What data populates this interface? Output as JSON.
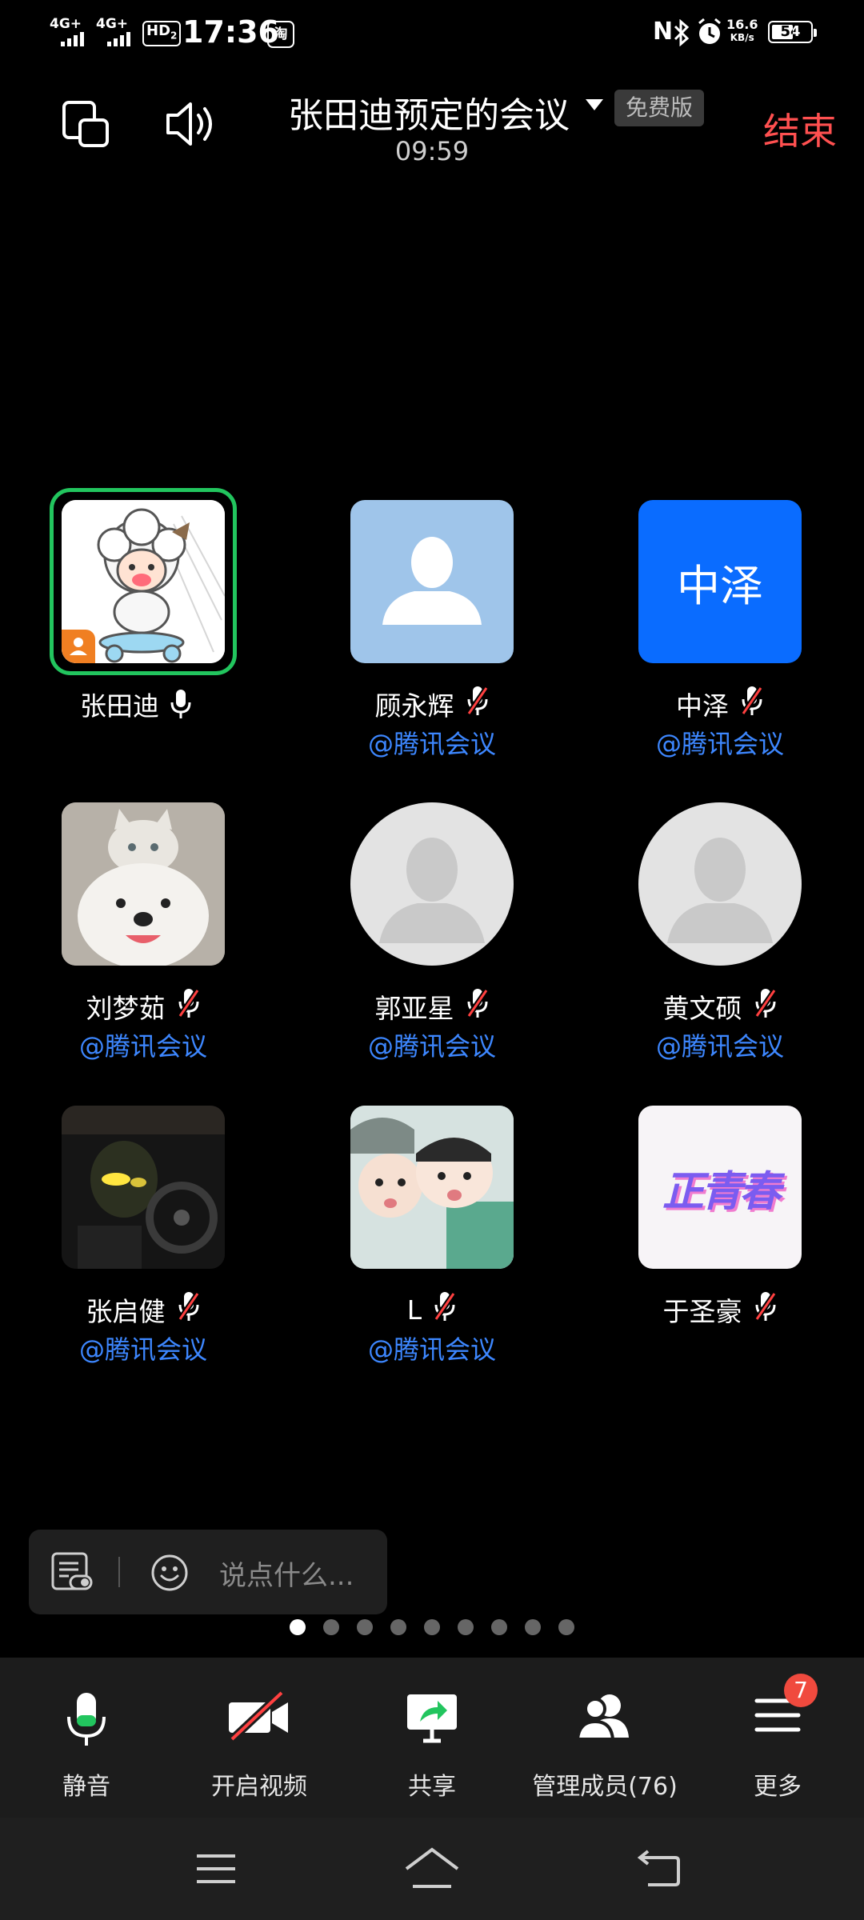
{
  "status_bar": {
    "sig1": "4G+",
    "sig2": "4G+",
    "hd": "HD",
    "hd_sub": "2",
    "time": "17:36",
    "app_badge": "淘",
    "speed_top": "16.6",
    "speed_bottom": "KB/s",
    "battery": "54"
  },
  "header": {
    "title": "张田迪预定的会议",
    "badge": "免费版",
    "timer": "09:59",
    "end_label": "结束"
  },
  "participants": [
    {
      "name": "张田迪",
      "mic": "on",
      "sub": "",
      "avatar": "cartoon-sheep",
      "host": true
    },
    {
      "name": "顾永辉",
      "mic": "off",
      "sub": "@腾讯会议",
      "avatar": "default-square"
    },
    {
      "name": "中泽",
      "mic": "off",
      "sub": "@腾讯会议",
      "avatar": "text",
      "avatar_text": "中泽"
    },
    {
      "name": "刘梦茹",
      "mic": "off",
      "sub": "@腾讯会议",
      "avatar": "cat-dog-photo"
    },
    {
      "name": "郭亚星",
      "mic": "off",
      "sub": "@腾讯会议",
      "avatar": "default-circle"
    },
    {
      "name": "黄文硕",
      "mic": "off",
      "sub": "@腾讯会议",
      "avatar": "default-circle"
    },
    {
      "name": "张启健",
      "mic": "off",
      "sub": "@腾讯会议",
      "avatar": "car-photo"
    },
    {
      "name": "L",
      "mic": "off",
      "sub": "@腾讯会议",
      "avatar": "kids-photo"
    },
    {
      "name": "于圣豪",
      "mic": "off",
      "sub": "",
      "avatar": "calligraphy",
      "avatar_text": "正青春"
    }
  ],
  "chat": {
    "placeholder": "说点什么..."
  },
  "pager": {
    "count": 9,
    "active": 0
  },
  "toolbar": {
    "mute": "静音",
    "video": "开启视频",
    "share": "共享",
    "members": "管理成员(76)",
    "more": "更多",
    "more_badge": "7"
  },
  "colors": {
    "accent_blue": "#3d87ff",
    "end_red": "#ff5050",
    "host_green": "#22c55e",
    "mic_green": "#22c55e"
  }
}
